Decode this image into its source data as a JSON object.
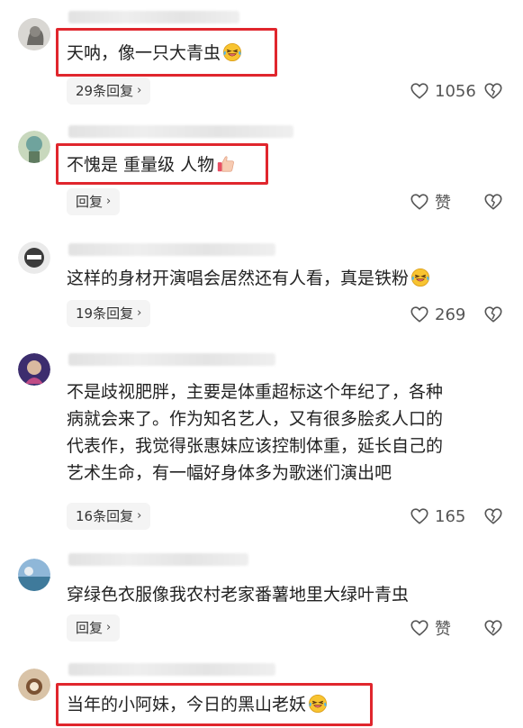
{
  "comments": [
    {
      "text_lines": [
        "天呐，像一只大青虫"
      ],
      "emoji": "laugh-cry-emoji",
      "reply_label": "29条回复",
      "like_count": "1056",
      "highlighted": true
    },
    {
      "text_lines": [
        "不愧是 重量级 人物"
      ],
      "emoji": "thumbs-up-emoji",
      "reply_label": "回复",
      "like_count": "赞",
      "highlighted": true
    },
    {
      "text_lines": [
        "这样的身材开演唱会居然还有人看，真是铁粉"
      ],
      "emoji": "laugh-cry-emoji",
      "reply_label": "19条回复",
      "like_count": "269",
      "highlighted": false
    },
    {
      "text_lines": [
        "不是歧视肥胖，主要是体重超标这个年纪了，各种",
        "病就会来了。作为知名艺人，又有很多脍炙人口的",
        "代表作，我觉得张惠妹应该控制体重，延长自己的",
        "艺术生命，有一幅好身体多为歌迷们演出吧"
      ],
      "emoji": "",
      "reply_label": "16条回复",
      "like_count": "165",
      "highlighted": false
    },
    {
      "text_lines": [
        "穿绿色衣服像我农村老家番薯地里大绿叶青虫"
      ],
      "emoji": "",
      "reply_label": "回复",
      "like_count": "赞",
      "highlighted": false
    },
    {
      "text_lines": [
        "当年的小阿妹，今日的黑山老妖"
      ],
      "emoji": "laugh-cry-emoji",
      "reply_label": "",
      "like_count": "",
      "highlighted": true
    }
  ],
  "colors": {
    "highlight_border": "#e0262d",
    "pill_background": "#f4f4f4",
    "text": "#222222",
    "meta": "#555555"
  }
}
